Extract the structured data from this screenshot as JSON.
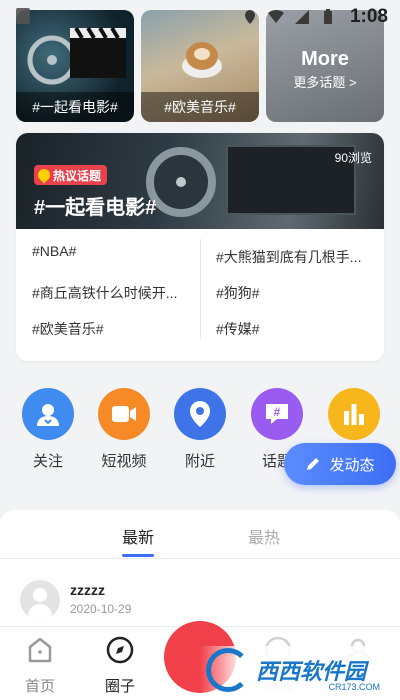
{
  "status_bar": {
    "time": "1:08"
  },
  "top_cards": [
    {
      "label": "#一起看电影#"
    },
    {
      "label": "#欧美音乐#"
    },
    {
      "title": "More",
      "subtitle": "更多话题 >"
    }
  ],
  "hot_topic": {
    "badge": "热议话题",
    "title": "#一起看电影#",
    "views": "90浏览",
    "items": [
      "#NBA#",
      "#大熊猫到底有几根手...",
      "#商丘高铁什么时候开...",
      "#狗狗#",
      "#欧美音乐#",
      "#传媒#"
    ]
  },
  "shortcuts": [
    {
      "label": "关注",
      "icon": "follow-icon",
      "color": "#3f8bf0"
    },
    {
      "label": "短视频",
      "icon": "video-icon",
      "color": "#f68a26"
    },
    {
      "label": "附近",
      "icon": "location-icon",
      "color": "#3e74e8"
    },
    {
      "label": "话题",
      "icon": "hashtag-icon",
      "color": "#9a5bf0"
    },
    {
      "label": "",
      "icon": "chart-icon",
      "color": "#f8b61d"
    }
  ],
  "fab": {
    "label": "发动态"
  },
  "feed": {
    "tabs": [
      "最新",
      "最热"
    ],
    "post": {
      "name": "zzzzz",
      "date": "2020-10-29"
    }
  },
  "bottom_nav": [
    "首页",
    "圈子",
    "消息",
    "我的"
  ],
  "watermark": {
    "text": "西西软件园",
    "sub": "CR173.COM"
  },
  "colors": {
    "accent": "#3c6ff5",
    "hot_red": "#e9424d",
    "center_red": "#f2404a"
  }
}
